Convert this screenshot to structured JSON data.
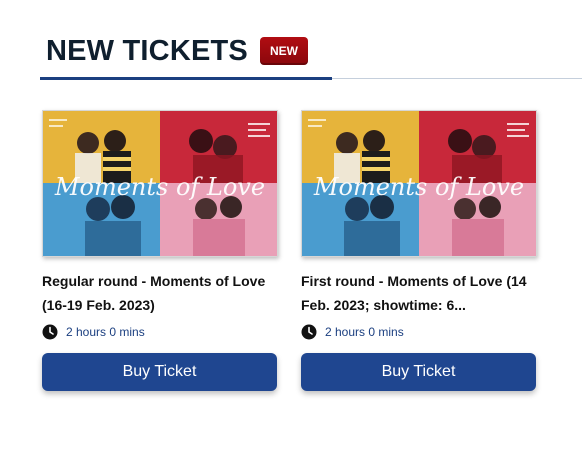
{
  "section": {
    "title": "NEW TICKETS",
    "badge": "NEW"
  },
  "cards": [
    {
      "title": "Regular round - Moments of Love (16-19 Feb. 2023)",
      "duration": "2 hours 0 mins",
      "button_label": "Buy Ticket",
      "poster_text": "Moments of Love"
    },
    {
      "title": "First round - Moments of Love (14 Feb. 2023; showtime: 6...",
      "duration": "2 hours 0 mins",
      "button_label": "Buy Ticket",
      "poster_text": "Moments of Love"
    }
  ],
  "colors": {
    "accent": "#1f4690",
    "badge": "#a50b10",
    "title": "#0f1f2e"
  },
  "icons": {
    "duration": "clock-icon"
  }
}
